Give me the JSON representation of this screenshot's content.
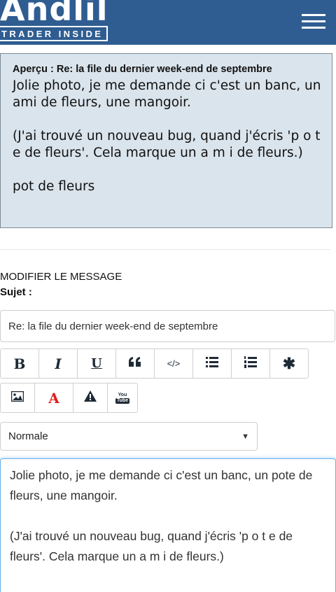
{
  "header": {
    "logo_text": "Andlil",
    "logo_tagline": "TRADER INSIDE",
    "menu_icon": "hamburger-menu-icon"
  },
  "preview": {
    "title": "Aperçu : Re: la file du dernier week-end de septembre",
    "paragraphs": [
      "Jolie photo, je me demande ci c'est un banc, un ami de fleurs, une mangoir.",
      "(J'ai trouvé un nouveau bug, quand j'écris 'p o t e de fleurs'. Cela marque un a m i de fleurs.)",
      "pot de fleurs"
    ]
  },
  "form": {
    "section_title": "MODIFIER LE MESSAGE",
    "subject_label": "Sujet :",
    "subject_value": "Re: la file du dernier week-end de septembre",
    "toolbar_row1": [
      {
        "name": "bold-button",
        "label": "B",
        "icon": "bold-icon"
      },
      {
        "name": "italic-button",
        "label": "I",
        "icon": "italic-icon"
      },
      {
        "name": "underline-button",
        "label": "U",
        "icon": "underline-icon"
      },
      {
        "name": "quote-button",
        "label": "",
        "icon": "quote-icon"
      },
      {
        "name": "code-button",
        "label": "</>",
        "icon": "code-icon"
      },
      {
        "name": "bullet-list-button",
        "label": "",
        "icon": "bullet-list-icon"
      },
      {
        "name": "numbered-list-button",
        "label": "",
        "icon": "numbered-list-icon"
      },
      {
        "name": "asterisk-button",
        "label": "",
        "icon": "asterisk-icon"
      }
    ],
    "toolbar_row2": [
      {
        "name": "image-button",
        "label": "",
        "icon": "image-icon"
      },
      {
        "name": "font-color-button",
        "label": "A",
        "icon": "font-color-icon"
      },
      {
        "name": "warning-button",
        "label": "",
        "icon": "warning-icon"
      },
      {
        "name": "youtube-button",
        "label": "You Tube",
        "icon": "youtube-icon"
      }
    ],
    "size_select_value": "Normale",
    "message_text": "Jolie photo, je me demande ci c'est un banc, un pote de fleurs, une mangoir.\n\n(J'ai trouvé un nouveau bug, quand j'écris 'p o t e de fleurs'. Cela marque un a m i de fleurs.)"
  },
  "colors": {
    "header_bg": "#2f5d91",
    "preview_bg": "#dae4ec",
    "textarea_focus": "#66afe9",
    "font_color_red": "#e21e1e"
  }
}
